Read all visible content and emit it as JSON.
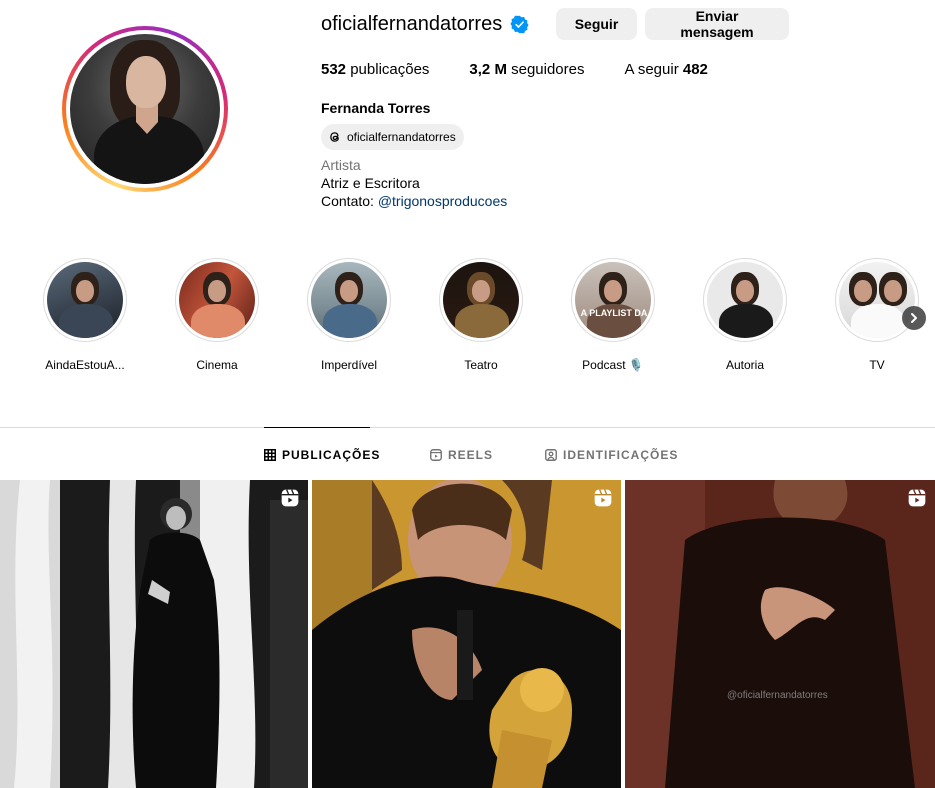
{
  "profile": {
    "username": "oficialfernandatorres",
    "verified": true,
    "follow_label": "Seguir",
    "message_label": "Enviar mensagem",
    "stats": {
      "posts": "532",
      "posts_label": "publicações",
      "followers": "3,2 M",
      "followers_label": "seguidores",
      "following_label": "A seguir",
      "following": "482"
    },
    "full_name": "Fernanda Torres",
    "threads_handle": "oficialfernandatorres",
    "category": "Artista",
    "bio_line1": "Atriz e Escritora",
    "bio_contact_prefix": "Contato:",
    "bio_contact_mention": "@trigonosproducoes"
  },
  "highlights": [
    {
      "label": "AindaEstouA...",
      "icon": "highlight-cover"
    },
    {
      "label": "Cinema",
      "icon": "highlight-cover"
    },
    {
      "label": "Imperdível",
      "icon": "highlight-cover"
    },
    {
      "label": "Teatro",
      "icon": "highlight-cover"
    },
    {
      "label": "Podcast 🎙️",
      "icon": "highlight-cover",
      "cover_text": "A PLAYLIST DA"
    },
    {
      "label": "Autoria",
      "icon": "highlight-cover"
    },
    {
      "label": "TV",
      "icon": "highlight-cover"
    }
  ],
  "tabs": [
    {
      "label": "PUBLICAÇÕES",
      "icon": "grid-icon",
      "active": true
    },
    {
      "label": "REELS",
      "icon": "reels-icon",
      "active": false
    },
    {
      "label": "IDENTIFICAÇÕES",
      "icon": "tagged-icon",
      "active": false
    }
  ],
  "posts": [
    {
      "type": "reel",
      "icon": "reel-icon"
    },
    {
      "type": "reel",
      "icon": "reel-icon"
    },
    {
      "type": "reel",
      "icon": "reel-icon",
      "watermark": "@oficialfernandatorres"
    }
  ],
  "colors": {
    "button_bg": "#efefef",
    "link": "#00376b",
    "muted": "#737373",
    "verified": "#0095f6",
    "border": "#dbdbdb"
  }
}
